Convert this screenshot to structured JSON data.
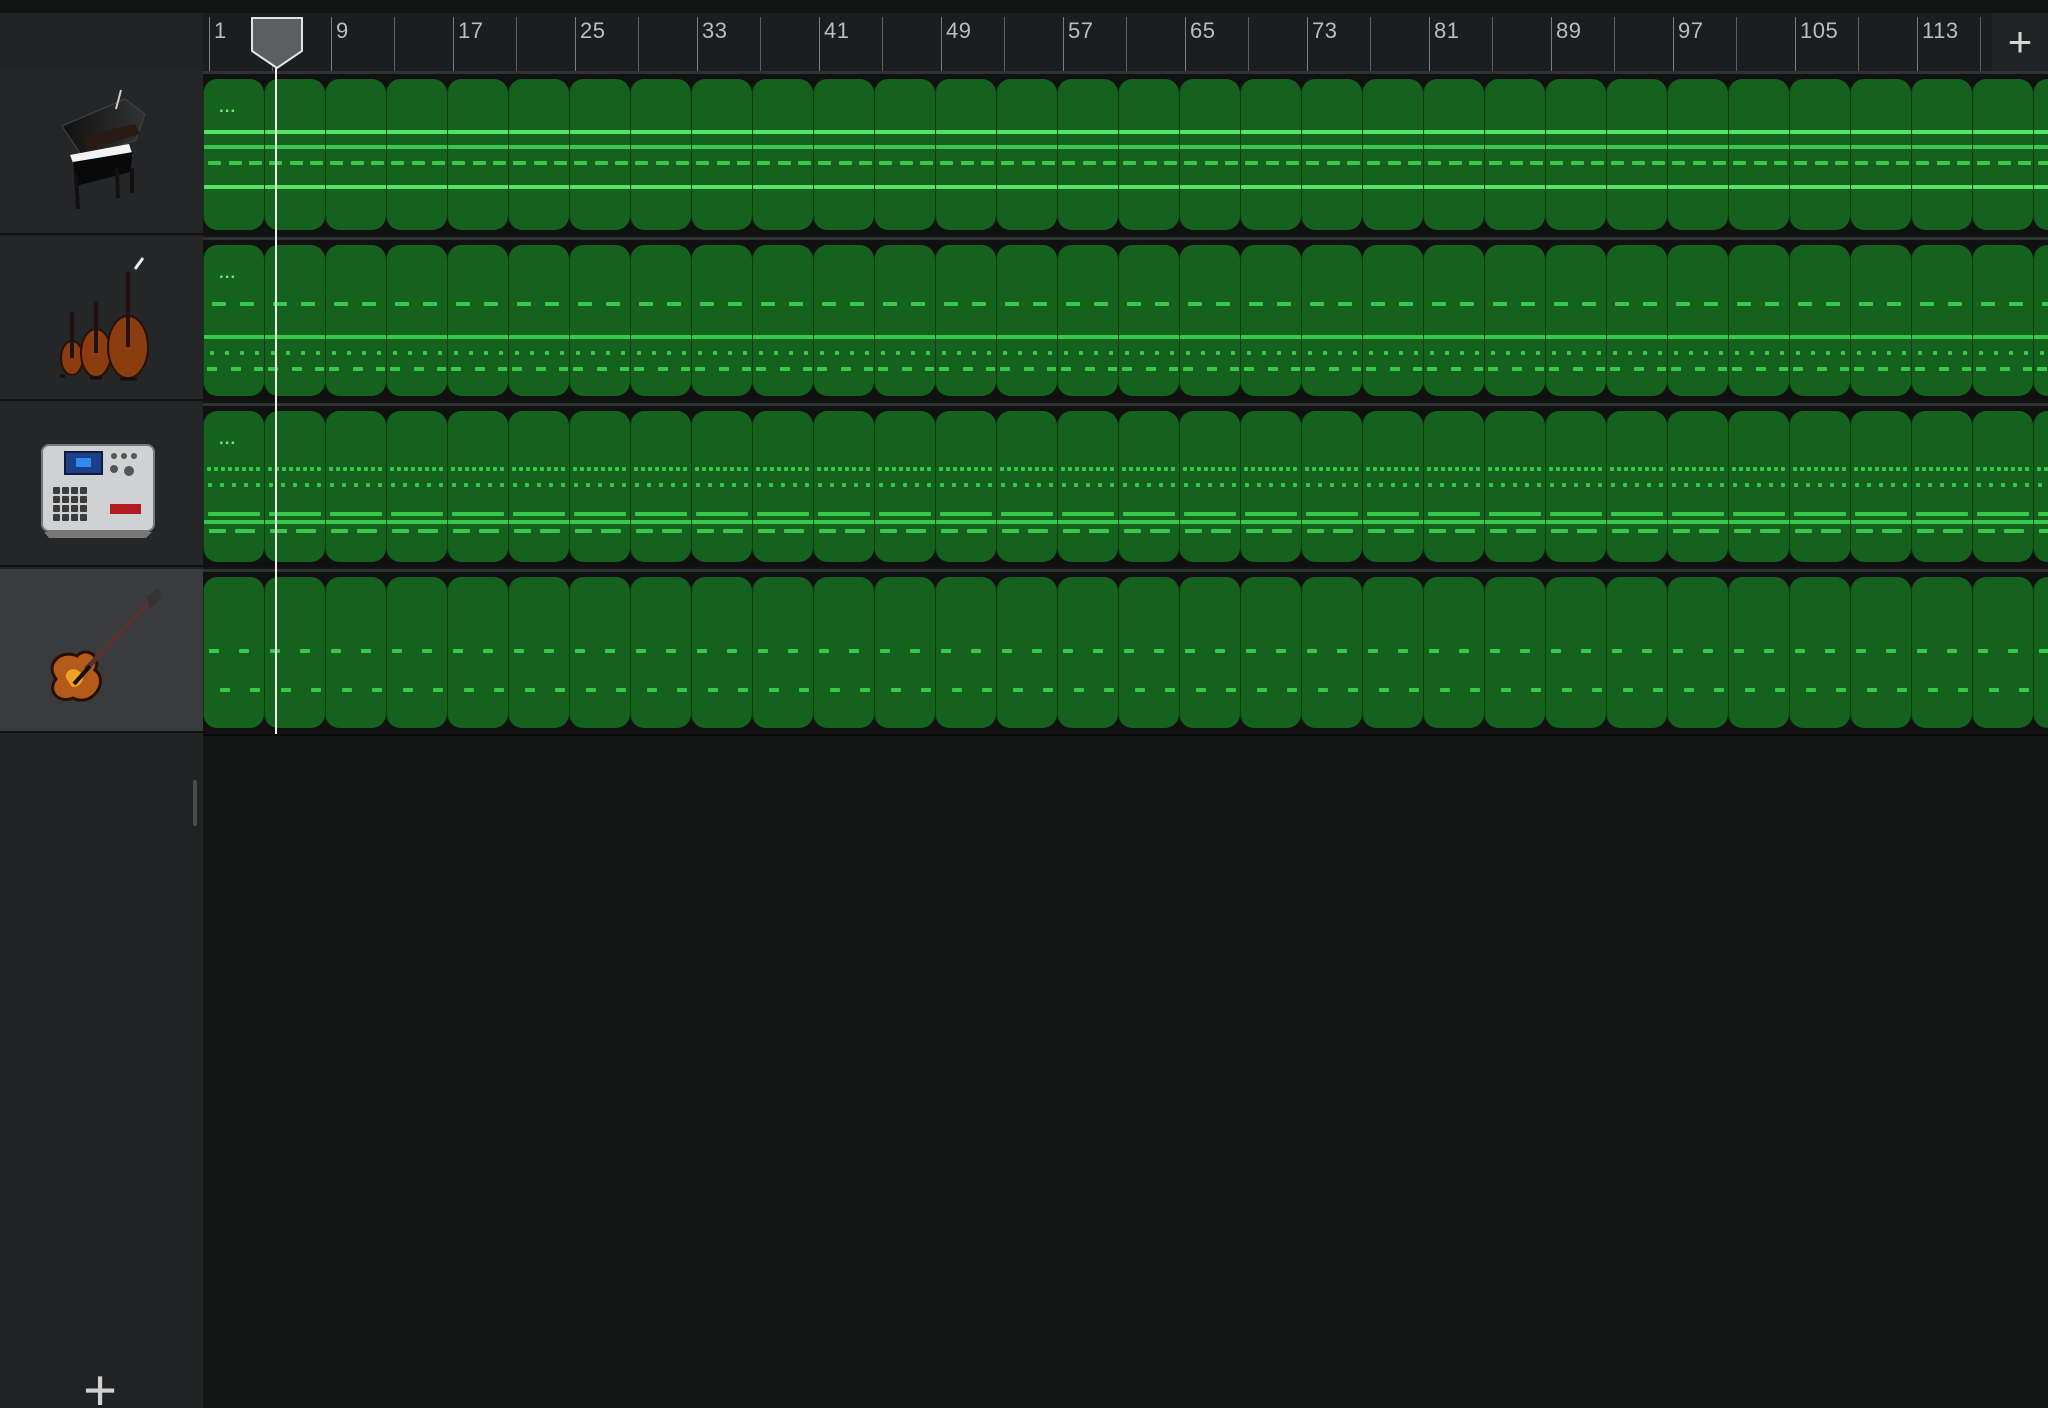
{
  "ruler": {
    "labels": [
      "1",
      "9",
      "17",
      "25",
      "33",
      "41",
      "49",
      "57",
      "65",
      "73",
      "81",
      "89",
      "97",
      "105",
      "113"
    ],
    "add_button": "+"
  },
  "tracks": [
    {
      "name": "grand-piano",
      "icon": "piano-icon",
      "selected": false
    },
    {
      "name": "strings",
      "icon": "strings-icon",
      "selected": false
    },
    {
      "name": "drum-machine",
      "icon": "drum-machine-icon",
      "selected": false
    },
    {
      "name": "bass",
      "icon": "bass-guitar-icon",
      "selected": true
    }
  ],
  "regions": {
    "track_labels": [
      "...",
      "...",
      "...",
      ""
    ]
  },
  "add_track": "+",
  "colors": {
    "region": "#14621e",
    "note": "#38c94b",
    "background": "#141616",
    "sidebar": "#202223",
    "playhead": "#f0f0f0"
  }
}
